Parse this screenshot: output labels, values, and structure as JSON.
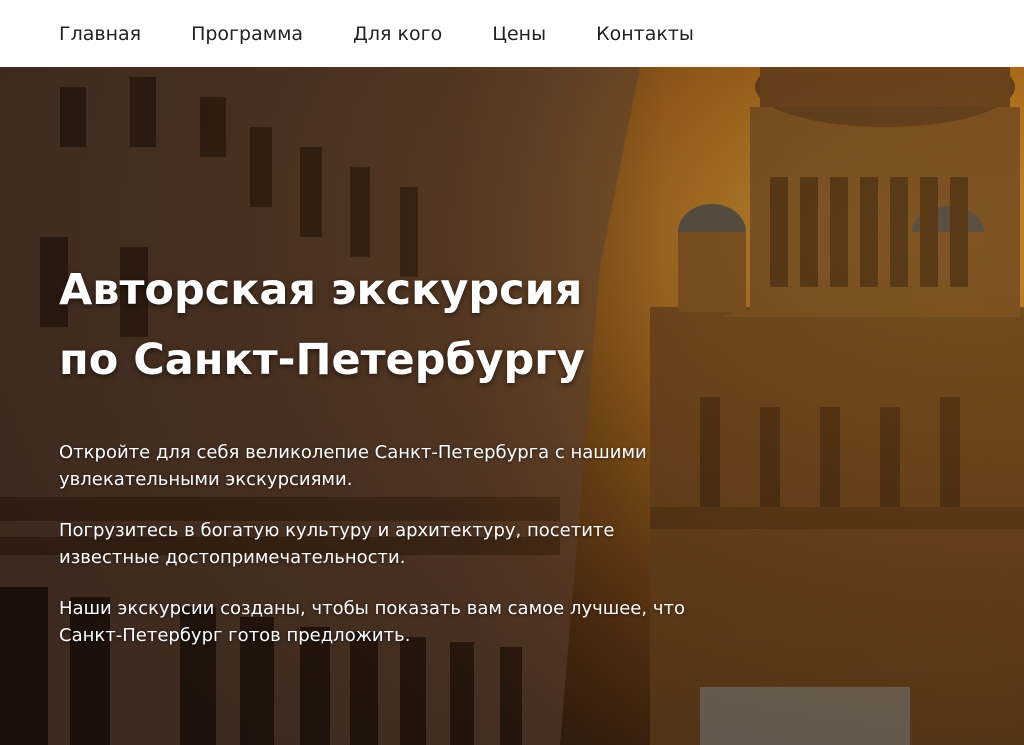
{
  "nav": {
    "items": [
      {
        "label": "Главная"
      },
      {
        "label": "Программа"
      },
      {
        "label": "Для кого"
      },
      {
        "label": "Цены"
      },
      {
        "label": "Контакты"
      }
    ]
  },
  "hero": {
    "title_line1": "Авторская экскурсия",
    "title_line2": "по Санкт-Петербургу",
    "paragraphs": [
      "Откройте для себя великолепие Санкт-Петербурга с нашими увлекательными экскурсиями.",
      "Погрузитесь в богатую культуру и архитектуру, посетите известные достопримечательности.",
      "Наши экскурсии созданы, чтобы показать вам самое лучшее, что Санкт-Петербург готов предложить."
    ],
    "background_image": "Saint Petersburg street with cathedral at sunset"
  },
  "colors": {
    "nav_bg": "#ffffff",
    "nav_text": "#222222",
    "hero_text": "#ffffff",
    "sky_accent": "#d89a3a"
  }
}
